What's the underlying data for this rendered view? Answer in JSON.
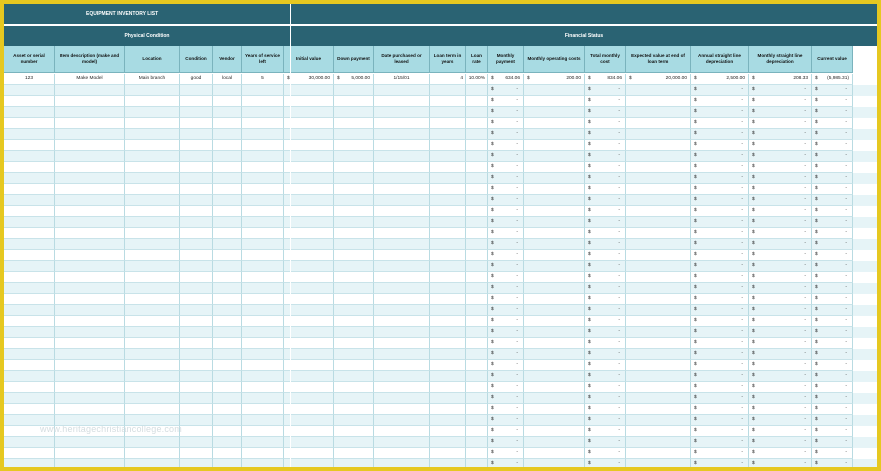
{
  "title": "EQUIPMENT INVENTORY LIST",
  "groups": {
    "physical": "Physical Condition",
    "financial": "Financial Status"
  },
  "columns": [
    "Asset or serial number",
    "Item description (make and model)",
    "Location",
    "Condition",
    "Vendor",
    "Years of service left",
    "Initial value",
    "Down payment",
    "Date purchased or leased",
    "Loan term in years",
    "Loan rate",
    "Monthly payment",
    "Monthly operating costs",
    "Total monthly cost",
    "Expected value at end of loan term",
    "Annual straight line depreciation",
    "Monthly straight line depreciation",
    "Current value"
  ],
  "first_row": {
    "asset": "123",
    "item": "Make Model",
    "location": "Main branch",
    "condition": "good",
    "vendor": "local",
    "years_left": "5",
    "initial_value": "30,000.00",
    "down_payment": "5,000.00",
    "date_purchased": "1/15/01",
    "loan_term": "4",
    "loan_rate": "10.00%",
    "monthly_payment": "634.06",
    "monthly_operating": "200.00",
    "total_monthly": "834.06",
    "expected_value": "20,000.00",
    "annual_depr": "2,500.00",
    "monthly_depr": "208.33",
    "current_value": "(5,985.31)"
  },
  "currency_symbol": "$",
  "empty_amount": "-",
  "watermark": "www.heritagechristiancollege.com",
  "colors": {
    "band": "#2a6373",
    "header": "#a8dbe3",
    "row_alt": "#e6f4f7",
    "frame": "#e6c820"
  }
}
